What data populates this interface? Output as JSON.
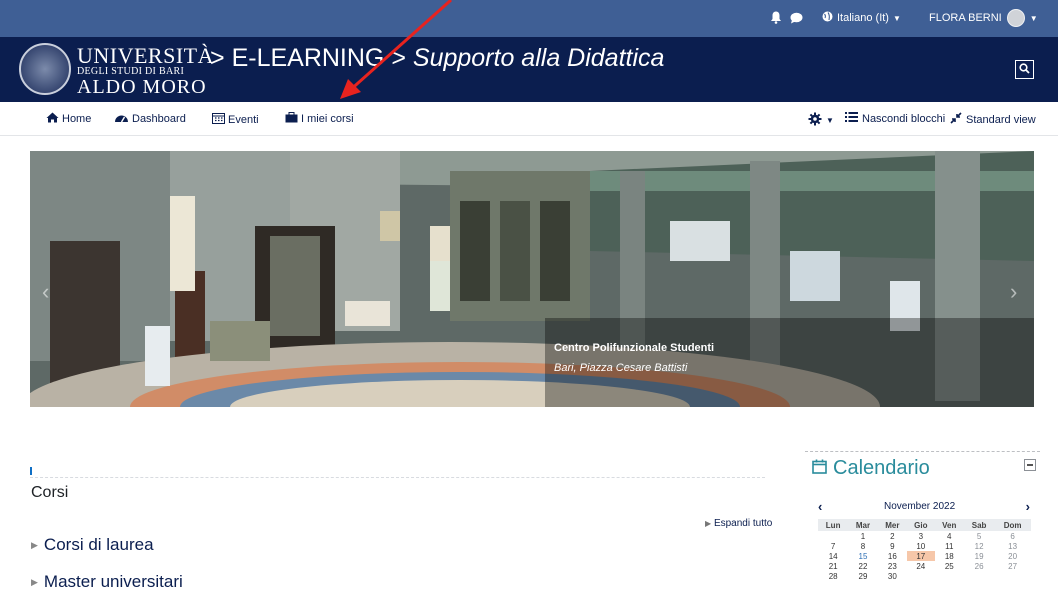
{
  "topbar": {
    "language": "Italiano (It)",
    "user": "FLORA BERNI"
  },
  "header": {
    "university_line1": "UNIVERSITÀ",
    "university_line2": "DEGLI STUDI DI BARI",
    "university_line3": "ALDO MORO",
    "breadcrumb_sep1": ">",
    "breadcrumb_1": "E-LEARNING",
    "breadcrumb_sep2": ">",
    "breadcrumb_2": "Supporto alla Didattica"
  },
  "navbar": {
    "items": [
      {
        "label": "Home",
        "icon": "home-icon"
      },
      {
        "label": "Dashboard",
        "icon": "dashboard-icon"
      },
      {
        "label": "Eventi",
        "icon": "calendar-icon"
      },
      {
        "label": "I miei corsi",
        "icon": "briefcase-icon"
      }
    ],
    "hide_blocks": "Nascondi blocchi",
    "standard_view": "Standard view"
  },
  "carousel": {
    "caption_title": "Centro Polifunzionale Studenti",
    "caption_subtitle": "Bari, Piazza Cesare Battisti"
  },
  "main": {
    "section_title": "Corsi",
    "expand_all": "Espandi tutto",
    "categories": [
      "Corsi di laurea",
      "Master universitari"
    ]
  },
  "calendar": {
    "title": "Calendario",
    "month": "November 2022",
    "weekdays": [
      "Lun",
      "Mar",
      "Mer",
      "Gio",
      "Ven",
      "Sab",
      "Dom"
    ],
    "weeks": [
      [
        "",
        "1",
        "2",
        "3",
        "4",
        "5",
        "6"
      ],
      [
        "7",
        "8",
        "9",
        "10",
        "11",
        "12",
        "13"
      ],
      [
        "14",
        "15",
        "16",
        "17",
        "18",
        "19",
        "20"
      ],
      [
        "21",
        "22",
        "23",
        "24",
        "25",
        "26",
        "27"
      ],
      [
        "28",
        "29",
        "30",
        "",
        "",
        "",
        ""
      ]
    ],
    "today": "17",
    "event_day": "15"
  },
  "colors": {
    "topbar": "#3f5f95",
    "header": "#0b1e4f",
    "accent": "#2a8c9c",
    "arrow": "#e8231f"
  }
}
